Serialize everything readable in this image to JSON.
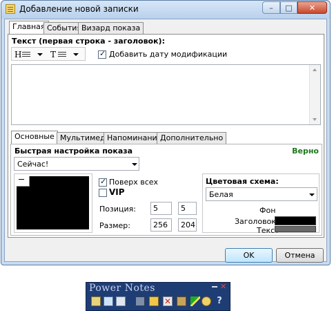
{
  "window": {
    "title": "Добавление новой записки",
    "controls": {
      "minimize": "–",
      "maximize": "□",
      "close": "✕"
    }
  },
  "tabs_top": [
    "Главная",
    "События",
    "Визард показа"
  ],
  "text_section": {
    "label": "Текст (первая строка - заголовок):",
    "toolbar": {
      "heading_btn": "H",
      "text_btn": "T"
    },
    "add_date_checkbox": {
      "label": "Добавить дату модификации",
      "checked": true
    }
  },
  "tabs_inner": [
    "Основные",
    "Мультимедиа",
    "Напоминание",
    "Дополнительно"
  ],
  "quick_setup": {
    "label": "Быстрая настройка показа",
    "status": "Верно",
    "status_color": "#1a7a1a",
    "selected": "Сейчас!"
  },
  "display": {
    "on_top": {
      "label": "Поверх всех",
      "checked": true
    },
    "vip": {
      "label": "VIP",
      "checked": false
    },
    "position_label": "Позиция:",
    "position_x": "5",
    "position_y": "5",
    "size_label": "Размер:",
    "size_w": "256",
    "size_h": "204"
  },
  "color_scheme": {
    "label": "Цветовая схема:",
    "selected": "Белая",
    "bg_label": "Фон",
    "title_label": "Заголовок",
    "text_label": "Текст",
    "title_color": "#000000",
    "text_color": "#6a6a6a"
  },
  "buttons": {
    "ok": "OK",
    "cancel": "Отмена"
  },
  "power_notes": {
    "title": "Power Notes",
    "icons": [
      "note-icon",
      "notes-list-icon",
      "calendar-icon",
      "keyboard-icon",
      "copy-icon",
      "delete-icon",
      "tools-icon",
      "edit-icon",
      "search-icon",
      "help-icon"
    ]
  }
}
